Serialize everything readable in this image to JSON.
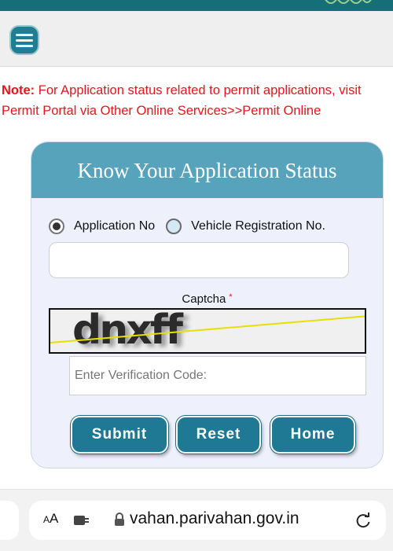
{
  "note": {
    "prefix": "Note:",
    "text": " For Application status related to permit applications, visit Permit Portal via Other Online Services>>Permit Online"
  },
  "card": {
    "title": "Know Your Application Status",
    "radio_application": "Application No",
    "radio_vehicle": "Vehicle Registration No.",
    "selected_option": "Application No",
    "application_value": "",
    "captcha_label": "Captcha",
    "captcha_required": "*",
    "captcha_text": "dnxff",
    "verification_placeholder": "Enter Verification Code:",
    "verification_value": "",
    "submit_label": "Submit",
    "reset_label": "Reset",
    "home_label": "Home"
  },
  "browser": {
    "text_size_label_big": "A",
    "text_size_label_small": "A",
    "url": "vahan.parivahan.gov.in"
  },
  "icons": {
    "menu": "hamburger-icon",
    "extension": "extension-icon",
    "lock": "lock-icon",
    "reload": "reload-icon"
  },
  "colors": {
    "header_teal": "#156f78",
    "card_header": "#57a3bb",
    "button": "#1f7894",
    "note_red": "#e8141c"
  }
}
